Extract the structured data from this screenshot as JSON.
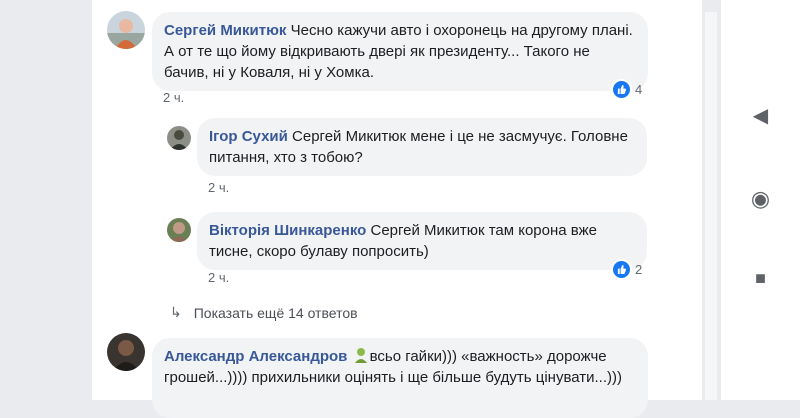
{
  "comments": [
    {
      "author": "Сергей Микитюк",
      "text": "Чесно кажучи авто і охоронець на другому плані. А от те що йому відкривають двері як президенту... Такого не бачив, ні у Коваля, ні у Хомка.",
      "time": "2 ч.",
      "reaction_count": "4",
      "reaction_icon": "like-icon"
    },
    {
      "author": "Ігор Сухий",
      "text": "Сергей Микитюк мене і це не засмучує. Головне питання, хто з тобою?",
      "time": "2 ч."
    },
    {
      "author": "Вікторія Шинкаренко",
      "text": "Сергей Микитюк там корона вже тисне, скоро булаву попросить)",
      "time": "2 ч.",
      "reaction_count": "2",
      "reaction_icon": "like-icon"
    },
    {
      "author": "Александр Александров",
      "text_before_emoji": "",
      "emoji_icon": "person-emoji-icon",
      "text": "всьо гайки))) «важность» дорожче грошей...)))) прихильники оцінять і ще більше будуть цінувати...)))"
    }
  ],
  "more_replies": {
    "arrow_icon": "reply-arrow-icon",
    "label": "Показать ещё 14 ответов"
  },
  "android_nav": {
    "back_icon": "back-triangle-icon",
    "home_icon": "home-circle-icon",
    "recents_icon": "recents-square-icon"
  },
  "colors": {
    "name": "#385898",
    "bubble": "#f2f3f5",
    "like": "#1877f2",
    "page_bg": "#e9ebee"
  }
}
